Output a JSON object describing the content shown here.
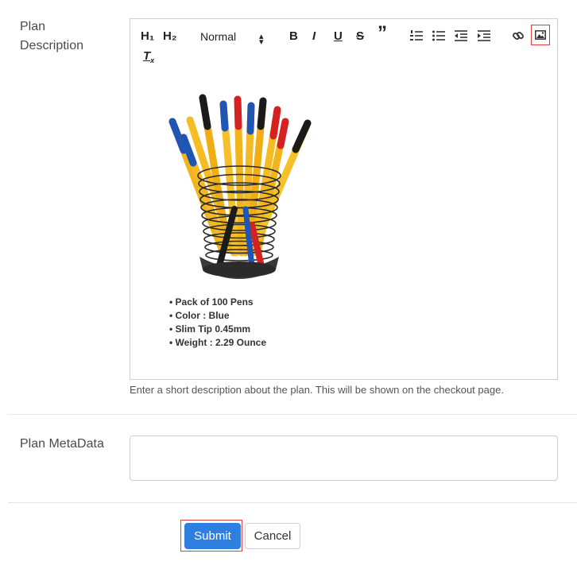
{
  "plan_description": {
    "label": "Plan Description",
    "toolbar": {
      "h1": "H₁",
      "h2": "H₂",
      "format_select": "Normal",
      "bold": "B",
      "italic": "I",
      "underline": "U",
      "strike": "S",
      "quote": "”"
    },
    "content": {
      "bullets": [
        "Pack of 100 Pens",
        "Color : Blue",
        "Slim Tip 0.45mm",
        "Weight  : 2.29 Ounce"
      ]
    },
    "hint": "Enter a short description about the plan. This will be shown on the checkout page."
  },
  "plan_metadata": {
    "label": "Plan MetaData",
    "value": ""
  },
  "actions": {
    "submit_label": "Submit",
    "cancel_label": "Cancel"
  },
  "colors": {
    "primary": "#2f7fe0",
    "highlight": "#e53a3a"
  }
}
